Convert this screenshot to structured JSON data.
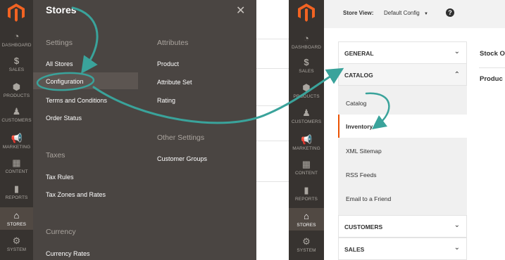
{
  "left_sidebar": {
    "items": [
      {
        "label": "DASHBOARD",
        "icon": "dashboard-icon"
      },
      {
        "label": "SALES",
        "icon": "dollar-icon"
      },
      {
        "label": "PRODUCTS",
        "icon": "cube-icon"
      },
      {
        "label": "CUSTOMERS",
        "icon": "person-icon"
      },
      {
        "label": "MARKETING",
        "icon": "megaphone-icon"
      },
      {
        "label": "CONTENT",
        "icon": "layout-icon"
      },
      {
        "label": "REPORTS",
        "icon": "bar-chart-icon"
      },
      {
        "label": "STORES",
        "icon": "storefront-icon"
      },
      {
        "label": "SYSTEM",
        "icon": "gear-icon"
      }
    ],
    "active": "STORES"
  },
  "stores_panel": {
    "title": "Stores",
    "settings": {
      "heading": "Settings",
      "items": [
        "All Stores",
        "Configuration",
        "Terms and Conditions",
        "Order Status"
      ]
    },
    "attributes": {
      "heading": "Attributes",
      "items": [
        "Product",
        "Attribute Set",
        "Rating"
      ]
    },
    "other_settings": {
      "heading": "Other Settings",
      "items": [
        "Customer Groups"
      ]
    },
    "taxes": {
      "heading": "Taxes",
      "items": [
        "Tax Rules",
        "Tax Zones and Rates"
      ]
    },
    "currency": {
      "heading": "Currency",
      "items": [
        "Currency Rates"
      ]
    }
  },
  "right_sidebar": {
    "items": [
      {
        "label": "DASHBOARD",
        "icon": "dashboard-icon"
      },
      {
        "label": "SALES",
        "icon": "dollar-icon"
      },
      {
        "label": "PRODUCTS",
        "icon": "cube-icon"
      },
      {
        "label": "CUSTOMERS",
        "icon": "person-icon"
      },
      {
        "label": "MARKETING",
        "icon": "megaphone-icon"
      },
      {
        "label": "CONTENT",
        "icon": "layout-icon"
      },
      {
        "label": "REPORTS",
        "icon": "bar-chart-icon"
      },
      {
        "label": "STORES",
        "icon": "storefront-icon"
      },
      {
        "label": "SYSTEM",
        "icon": "gear-icon"
      }
    ],
    "active": "STORES"
  },
  "store_view": {
    "label": "Store View:",
    "value": "Default Config",
    "help": "?"
  },
  "config_tabs": {
    "general": "GENERAL",
    "catalog": "CATALOG",
    "catalog_items": [
      "Catalog",
      "Inventory",
      "XML Sitemap",
      "RSS Feeds",
      "Email to a Friend"
    ],
    "active_item": "Inventory",
    "customers": "CUSTOMERS",
    "sales": "SALES"
  },
  "content": {
    "heading1": "Stock O",
    "heading2": "Produc"
  },
  "colors": {
    "sidebar": "#373330",
    "panel": "#4a4542",
    "accent_arrow": "#3aa39b",
    "active_border": "#eb5202"
  }
}
